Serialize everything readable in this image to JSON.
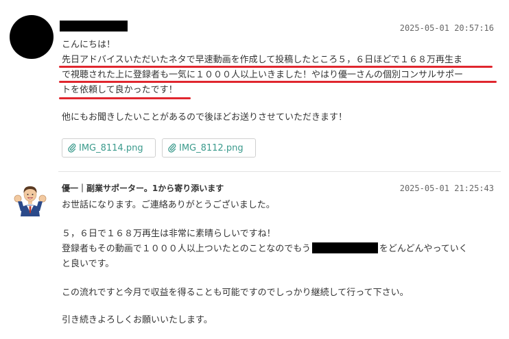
{
  "message1": {
    "timestamp": "2025-05-01 20:57:16",
    "greeting": "こんにちは！",
    "body_lines": [
      "先日アドバイスいただいたネタで早速動画を作成して投稿したところ５，６日ほどで１６８万再生ま",
      "で視聴された上に登録者も一気に１０００人以上いきました！やはり優一さんの個別コンサルサポー",
      "トを依頼して良かったです！"
    ],
    "followup": "他にもお聞きしたいことがあるので後ほどお送りさせていただきます！",
    "attachments": [
      "IMG_8114.png",
      "IMG_8112.png"
    ],
    "underline_color": "#e0262e"
  },
  "message2": {
    "sender": "優一｜副業サポーター。1から寄り添います",
    "timestamp": "2025-05-01 21:25:43",
    "line1": "お世話になります。ご連絡ありがとうございました。",
    "line2": "５，６日で１６８万再生は非常に素晴らしいですね！",
    "line3a": "登録者もその動画で１０００人以上ついたとのことなのでもう",
    "line3b": "をどんどんやっていく",
    "line4": "と良いです。",
    "line5": "この流れですと今月で収益を得ることも可能ですのでしっかり継続して行って下さい。",
    "line6": "引き続きよろしくお願いいたします。"
  },
  "colors": {
    "link": "#3a9a8c",
    "accent_red": "#e0262e"
  }
}
